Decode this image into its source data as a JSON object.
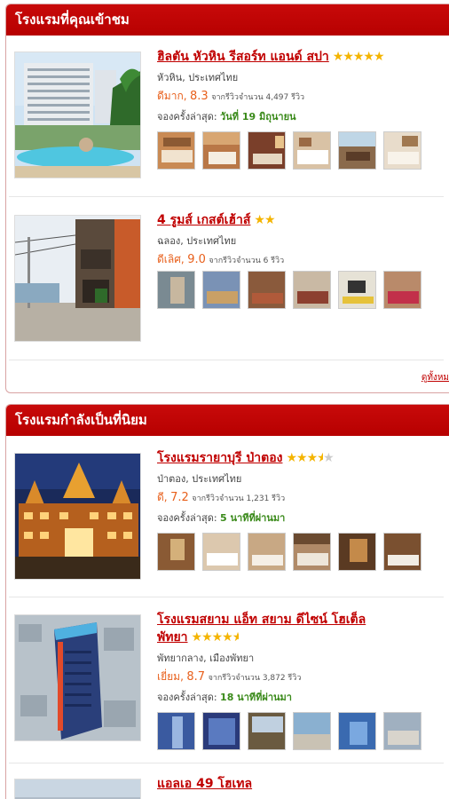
{
  "sections": [
    {
      "title": "โรงแรมที่คุณเข้าชม",
      "more_link": "ดูทั้งหม",
      "hotels": [
        {
          "name": "ฮิลตัน หัวหิน รีสอร์ท แอนด์ สปา",
          "stars": 5,
          "location": "หัวหิน, ประเทศไทย",
          "rating_word": "ดีมาก,",
          "rating_score": "8.3",
          "reviews": "จากรีวิวจำนวน 4,497 รีวิว",
          "booked_label": "จองครั้งล่าสุด:",
          "booked_time": "วันที่ 19 มิถุนายน"
        },
        {
          "name": "4 รูมส์ เกสต์เฮ้าส์",
          "stars": 2,
          "location": "ฉลอง, ประเทศไทย",
          "rating_word": "ดีเลิศ,",
          "rating_score": "9.0",
          "reviews": "จากรีวิวจำนวน 6 รีวิว",
          "booked_label": "",
          "booked_time": ""
        }
      ]
    },
    {
      "title": "โรงแรมกำลังเป็นที่นิยม",
      "hotels": [
        {
          "name": "โรงแรมรายาบุรี ป่าตอง",
          "stars": 3.5,
          "location": "ป่าตอง, ประเทศไทย",
          "rating_word": "ดี,",
          "rating_score": "7.2",
          "reviews": "จากรีวิวจำนวน 1,231 รีวิว",
          "booked_label": "จองครั้งล่าสุด:",
          "booked_time": "5 นาทีที่ผ่านมา"
        },
        {
          "name": "โรงแรมสยาม แอ็ท สยาม ดีไซน์ โฮเต็ล พัทยา",
          "stars": 4.5,
          "location": "พัทยากลาง, เมืองพัทยา",
          "rating_word": "เยี่ยม,",
          "rating_score": "8.7",
          "reviews": "จากรีวิวจำนวน 3,872 รีวิว",
          "booked_label": "จองครั้งล่าสุด:",
          "booked_time": "18 นาทีที่ผ่านมา"
        },
        {
          "name": "แอลเอ 49 โฮเทล"
        }
      ]
    }
  ],
  "colors": {
    "header_red": "#c00000",
    "link_red": "#c00000",
    "rating_orange": "#e8601c",
    "recent_green": "#3a8a1a",
    "star_gold": "#f4b400"
  }
}
